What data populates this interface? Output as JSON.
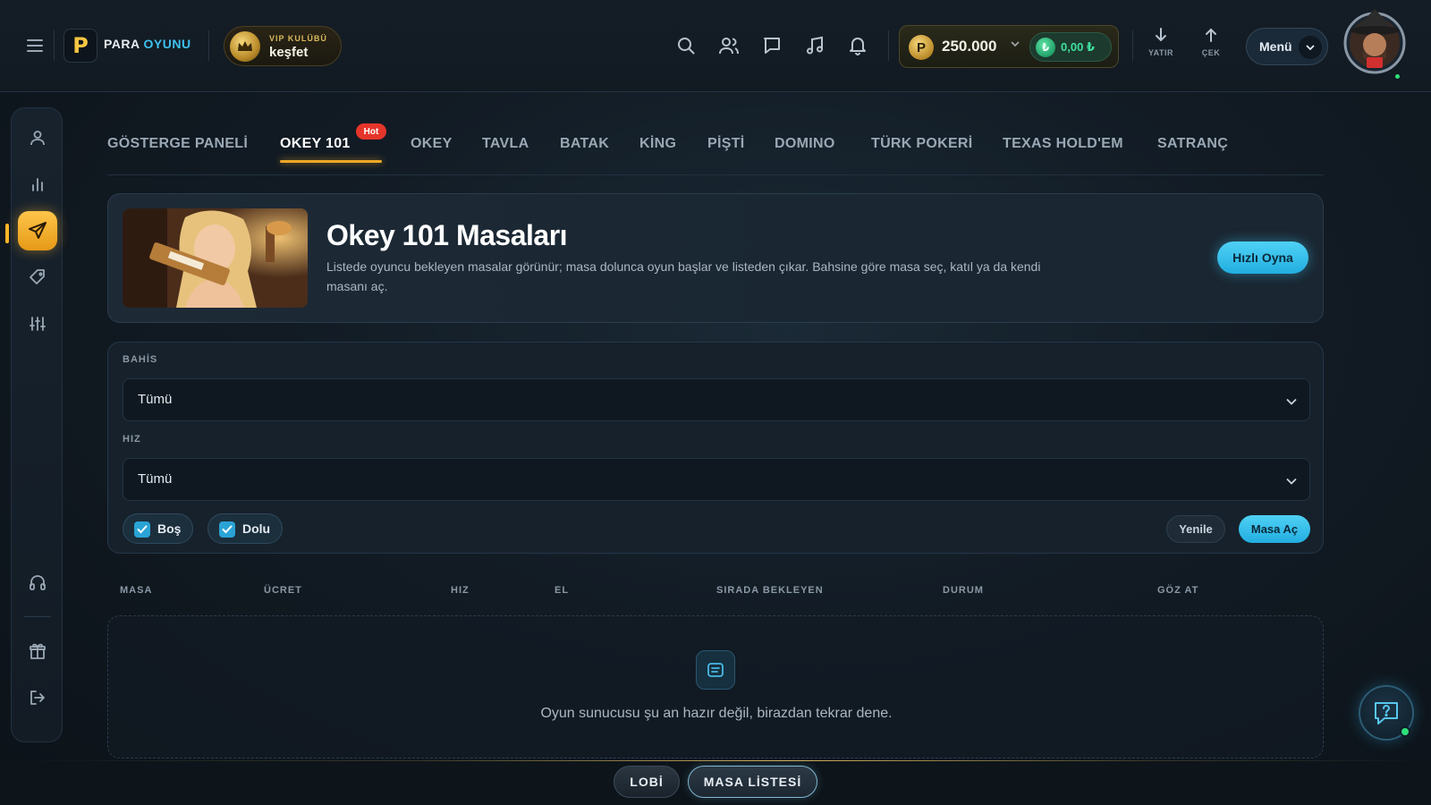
{
  "brand": {
    "word1": "PARA",
    "word2": "OYUNU",
    "logo_letter": "P"
  },
  "vip": {
    "small": "VIP KULÜBÜ",
    "big": "keşfet"
  },
  "header_icons": [
    "search-icon",
    "users-icon",
    "chat-icon",
    "music-icon",
    "bell-icon"
  ],
  "wallet": {
    "coin_letter": "P",
    "amount": "250.000",
    "tl_amount": "0,00 ₺",
    "tl_symbol": "₺"
  },
  "cash": {
    "deposit": "YATIR",
    "withdraw": "ÇEK"
  },
  "menu": {
    "label": "Menü"
  },
  "tabs": [
    {
      "label": "GÖSTERGE PANELİ"
    },
    {
      "label": "OKEY 101",
      "active": true,
      "badge": "Hot"
    },
    {
      "label": "OKEY"
    },
    {
      "label": "TAVLA"
    },
    {
      "label": "BATAK"
    },
    {
      "label": "KİNG"
    },
    {
      "label": "PİŞTİ"
    },
    {
      "label": "DOMINO"
    },
    {
      "label": "TÜRK POKERİ"
    },
    {
      "label": "TEXAS HOLD'EM"
    },
    {
      "label": "SATRANÇ"
    }
  ],
  "hero": {
    "title": "Okey 101 Masaları",
    "description": "Listede oyuncu bekleyen masalar görünür; masa dolunca oyun başlar ve listeden çıkar. Bahsine göre masa seç, katıl ya da kendi masanı aç.",
    "quick_play": "Hızlı Oyna"
  },
  "filters": {
    "bet_label": "BAHİS",
    "bet_value": "Tümü",
    "speed_label": "HIZ",
    "speed_value": "Tümü",
    "empty_chip": "Boş",
    "full_chip": "Dolu",
    "refresh": "Yenile",
    "open_table": "Masa Aç"
  },
  "table": {
    "headers": [
      "MASA",
      "ÜCRET",
      "HIZ",
      "EL",
      "SIRADA BEKLEYEN",
      "DURUM",
      "GÖZ AT"
    ],
    "empty_message": "Oyun sunucusu şu an hazır değil, birazdan tekrar dene."
  },
  "bottom_nav": {
    "lobby": "LOBİ",
    "table_list": "MASA LİSTESİ"
  },
  "colors": {
    "accent": "#22aee0",
    "active_nav": "#f1a828",
    "hot": "#e5352b",
    "online": "#2ee07a"
  }
}
